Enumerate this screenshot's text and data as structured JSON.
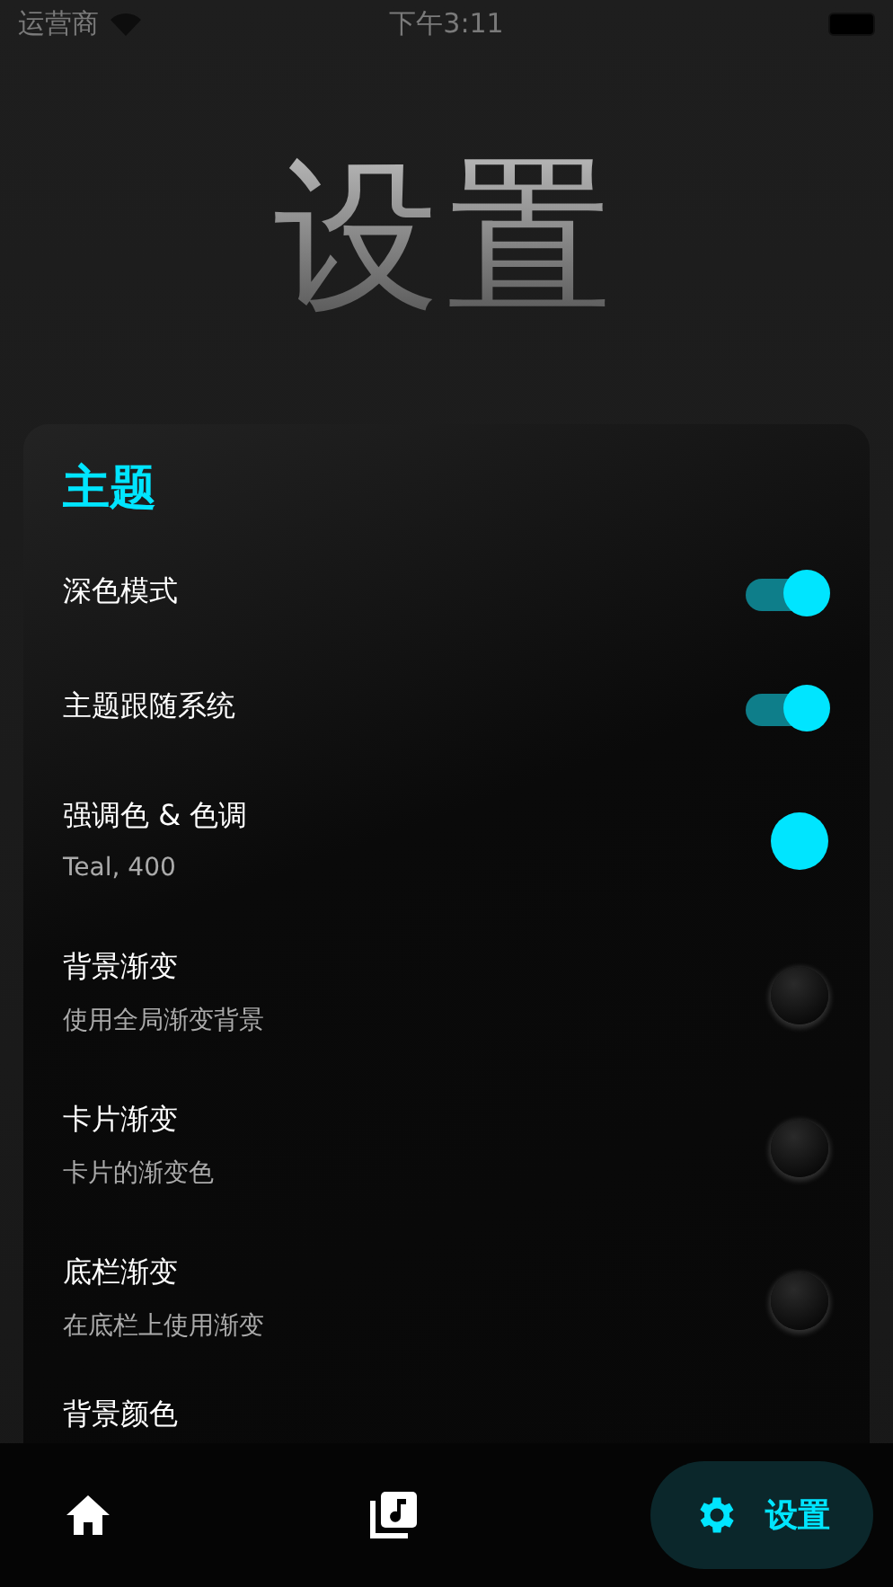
{
  "status_bar": {
    "carrier": "运营商",
    "time": "下午3:11"
  },
  "title": "设置",
  "section": {
    "title": "主题",
    "rows": [
      {
        "kind": "switch",
        "label": "深色模式",
        "on": true
      },
      {
        "kind": "switch",
        "label": "主题跟随系统",
        "on": true
      },
      {
        "kind": "color",
        "label": "强调色 & 色调",
        "subtitle": "Teal, 400",
        "color": "#00e5ff"
      },
      {
        "kind": "switch",
        "label": "背景渐变",
        "subtitle": "使用全局渐变背景",
        "on": false
      },
      {
        "kind": "switch",
        "label": "卡片渐变",
        "subtitle": "卡片的渐变色",
        "on": false
      },
      {
        "kind": "switch",
        "label": "底栏渐变",
        "subtitle": "在底栏上使用渐变",
        "on": false
      },
      {
        "kind": "plain",
        "label": "背景颜色"
      }
    ]
  },
  "nav": [
    {
      "kind": "home",
      "selected": false
    },
    {
      "kind": "library",
      "selected": false
    },
    {
      "kind": "settings",
      "label": "设置",
      "selected": true
    }
  ]
}
